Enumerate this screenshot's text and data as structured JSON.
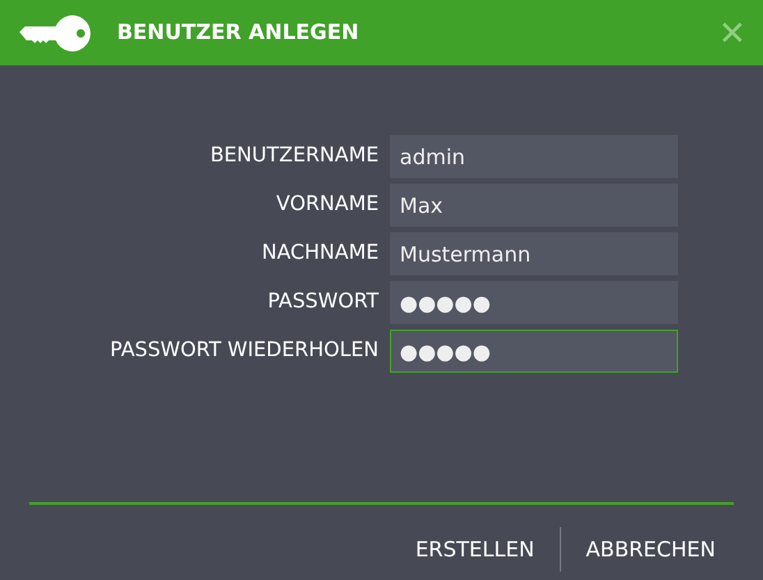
{
  "window": {
    "title": "BENUTZER ANLEGEN",
    "close": "✕"
  },
  "fields": [
    {
      "label": "BENUTZERNAME",
      "value": "admin",
      "focused": false
    },
    {
      "label": "VORNAME",
      "value": "Max",
      "focused": false
    },
    {
      "label": "NACHNAME",
      "value": "Mustermann",
      "focused": false
    },
    {
      "label": "PASSWORT",
      "value": "●●●●●",
      "focused": false
    },
    {
      "label": "PASSWORT WIEDERHOLEN",
      "value": "●●●●●",
      "focused": true
    }
  ],
  "buttons": [
    "ERSTELLEN",
    "ABBRECHEN"
  ]
}
